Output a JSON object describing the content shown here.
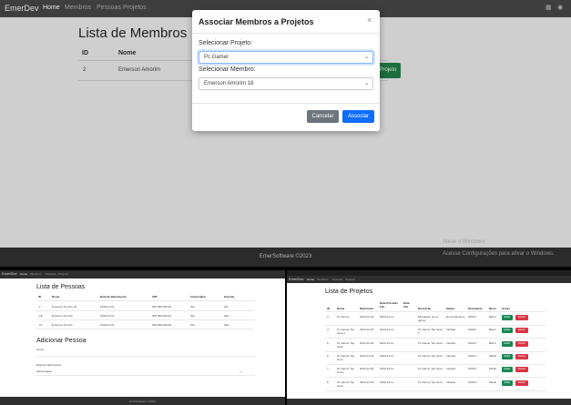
{
  "top": {
    "brand": "EmerDev",
    "nav": [
      "Home",
      "Membros",
      "Pessoas",
      "Projetos"
    ],
    "page_title": "Lista de Membros",
    "columns": [
      "ID",
      "Nome"
    ],
    "row": {
      "id": "2",
      "name": "Emerson Amorim"
    },
    "bg_button": "Projeto",
    "footer": "EmerSoftware ©2023",
    "windows_activate": "Ativar o Windows",
    "windows_sub": "Acesse Configurações para ativar o Windows.",
    "modal": {
      "title": "Associar Membros a Projetos",
      "close": "×",
      "project_label": "Selecionar Projeto:",
      "project_value": "Pc Gamer",
      "member_label": "Selecionar Membro:",
      "member_value": "Emerson Amorim 18",
      "cancel": "Cancelar",
      "submit": "Associar"
    }
  },
  "bottom_left": {
    "brand": "EmerDev",
    "nav": [
      "Home",
      "Membros",
      "Pessoas",
      "Projetos"
    ],
    "title": "Lista de Pessoas",
    "columns": [
      "ID",
      "Nome",
      "Data de Nascimento",
      "CPF",
      "Funcionário",
      "Gerente"
    ],
    "rows": [
      [
        "1",
        "Emerson Amorim 01",
        "1990-01-01",
        "000.000.000-00",
        "Sim",
        "Sim"
      ],
      [
        "18",
        "Emerson Amorim",
        "1990-01-01",
        "000.000.000-00",
        "Sim",
        "Não"
      ],
      [
        "19",
        "Emerson Amorim",
        "1990-01-01",
        "000.000.000-00",
        "Sim",
        "Não"
      ]
    ],
    "form_title": "Adicionar Pessoa",
    "form_field": "Nome",
    "date_label": "Data de Nascimento",
    "date_placeholder": "dd/mm/aaaa",
    "footer": "EmerSoftware ©2023"
  },
  "bottom_right": {
    "brand": "EmerDev",
    "nav": [
      "Home",
      "Membros",
      "Pessoas",
      "Projetos"
    ],
    "title": "Lista de Projetos",
    "columns": [
      "ID",
      "Nome",
      "Data Início",
      "Data Previsão Fim",
      "Data Fim",
      "Descrição",
      "Status",
      "Orçamento",
      "Risco",
      "Ações"
    ],
    "rows": [
      [
        "3",
        "Pc Gamer",
        "2023-12-04",
        "2023-12-11",
        "",
        "Montagem de pc gamer",
        "Em Andamento",
        "2000.0",
        "Baixo"
      ],
      [
        "4",
        "Pc Gamer Top Gera 1",
        "2023-12-04",
        "2023-12-11",
        "",
        "Pc Gamer Top Gera 1",
        "Iniciado",
        "1000.0",
        "Baixo"
      ],
      [
        "5",
        "Pc Gamer Top Gera",
        "2023-12-04",
        "2023-12-11",
        "",
        "Pc Gamer Top Gera",
        "Iniciado",
        "1000.0",
        "Baixo"
      ],
      [
        "6",
        "Pc Gamer Top Gera",
        "2023-12-04",
        "2023-12-11",
        "",
        "Pc Gamer Top Gera",
        "Iniciado",
        "1000.0",
        "Médio"
      ],
      [
        "7",
        "Pc Gamer Top Gera",
        "2023-12-04",
        "2023-12-11",
        "",
        "Pc Gamer Top Gera",
        "Iniciado",
        "1000.0",
        "Médio"
      ],
      [
        "8",
        "Pc Gamer Top Gera",
        "2023-12-04",
        "2023-12-11",
        "",
        "Pc Gamer Top Gera",
        "Iniciado",
        "1000.0",
        "Médio"
      ]
    ],
    "edit": "Editar",
    "delete": "Excluir"
  }
}
